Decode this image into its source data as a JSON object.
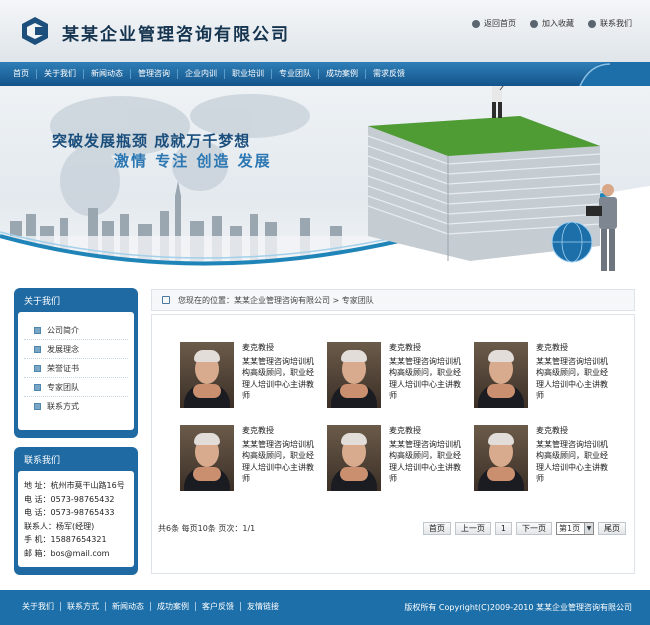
{
  "header": {
    "site_title": "某某企业管理咨询有限公司",
    "top_links": [
      "返回首页",
      "加入收藏",
      "联系我们"
    ]
  },
  "nav": {
    "items": [
      "首页",
      "关于我们",
      "新闻动态",
      "管理咨询",
      "企业内训",
      "职业培训",
      "专业团队",
      "成功案例",
      "需求反馈"
    ]
  },
  "banner": {
    "slogan_line1": "突破发展瓶颈 成就万千梦想",
    "slogan_line2": "激情 专注 创造 发展"
  },
  "about_box": {
    "title": "关于我们",
    "items": [
      "公司简介",
      "发展理念",
      "荣誉证书",
      "专家团队",
      "联系方式"
    ]
  },
  "contact_box": {
    "title": "联系我们",
    "lines": [
      "地  址：杭州市莫干山路16号",
      "电  话：0573-98765432",
      "电  话：0573-98765433",
      "联系人：杨军(经理)",
      "手  机：15887654321",
      "邮  箱：bos@mail.com"
    ]
  },
  "breadcrumb": {
    "text": "您现在的位置：某某企业管理咨询有限公司  > 专家团队"
  },
  "experts": [
    {
      "name": "麦克教授",
      "desc": "某某管理咨询培训机构高级顾问，职业经理人培训中心主讲教师"
    },
    {
      "name": "麦克教授",
      "desc": "某某管理咨询培训机构高级顾问，职业经理人培训中心主讲教师"
    },
    {
      "name": "麦克教授",
      "desc": "某某管理咨询培训机构高级顾问，职业经理人培训中心主讲教师"
    },
    {
      "name": "麦克教授",
      "desc": "某某管理咨询培训机构高级顾问，职业经理人培训中心主讲教师"
    },
    {
      "name": "麦克教授",
      "desc": "某某管理咨询培训机构高级顾问，职业经理人培训中心主讲教师"
    },
    {
      "name": "麦克教授",
      "desc": "某某管理咨询培训机构高级顾问，职业经理人培训中心主讲教师"
    }
  ],
  "pager": {
    "info": "共6条  每页10条  页次：1/1",
    "first": "首页",
    "prev": "上一页",
    "current": "1",
    "next": "下一页",
    "select_value": "第1页",
    "last": "尾页"
  },
  "footer": {
    "links": [
      "关于我们",
      "联系方式",
      "新闻动态",
      "成功案例",
      "客户反馈",
      "友情链接"
    ],
    "copyright": "版权所有 Copyright(C)2009-2010 某某企业管理咨询有限公司"
  },
  "colors": {
    "primary": "#1d6fa9",
    "nav_dark": "#13548a",
    "title_dark": "#15344f"
  }
}
